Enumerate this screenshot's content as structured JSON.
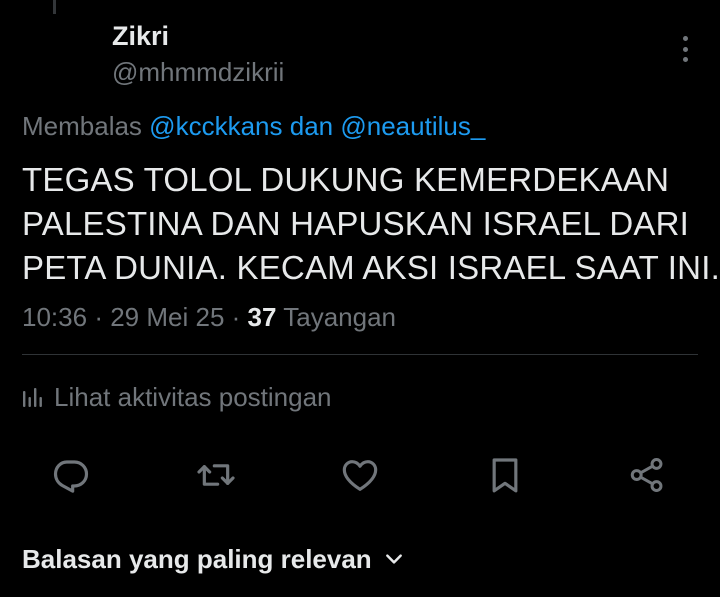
{
  "author": {
    "name": "Zikri",
    "handle": "@mhmmdzikrii"
  },
  "reply": {
    "prefix": "Membalas",
    "mention_1": "@kcckkans",
    "joiner": "dan",
    "mention_2": "@neautilus_"
  },
  "tweet": {
    "lines": [
      "TEGAS TOLOL DUKUNG KEMERDEKAAN",
      "PALESTINA DAN HAPUSKAN ISRAEL DARI",
      "PETA DUNIA. KECAM AKSI ISRAEL SAAT INI."
    ]
  },
  "meta": {
    "time": "10:36",
    "date": "29 Mei 25",
    "separator": "·",
    "views_count": "37",
    "views_label": "Tayangan"
  },
  "activity": {
    "label": "Lihat aktivitas postingan"
  },
  "actions": {
    "icons": [
      "reply-icon",
      "repost-icon",
      "like-icon",
      "bookmark-icon",
      "share-icon"
    ]
  },
  "sort": {
    "label": "Balasan yang paling relevan"
  },
  "colors": {
    "background": "#000000",
    "text_primary": "#e7e9ea",
    "text_secondary": "#71767b",
    "link": "#1d9bf0",
    "divider": "#2f3336"
  }
}
